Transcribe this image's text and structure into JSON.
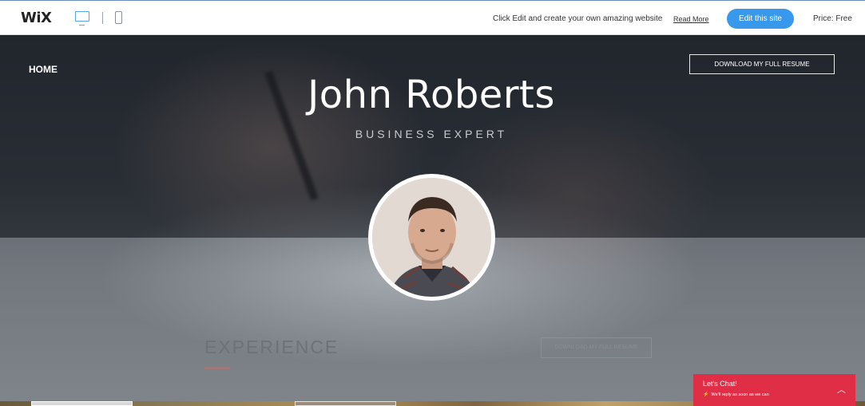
{
  "topbar": {
    "logo": "WiX",
    "promo_text": "Click Edit and create your own amazing website",
    "read_more": "Read More",
    "edit_button": "Edit this site",
    "price": "Price: Free"
  },
  "hero": {
    "nav_home": "HOME",
    "download_resume": "DOWNLOAD MY FULL RESUME",
    "name": "John Roberts",
    "subtitle": "BUSINESS EXPERT"
  },
  "experience": {
    "title": "EXPERIENCE",
    "download_resume": "DOWNLOAD MY FULL RESUME"
  },
  "chat": {
    "title": "Let's Chat!",
    "subtitle": "We'll reply as soon as we can",
    "bolt_icon": "lightning-icon",
    "chevron_icon": "chevron-up-icon"
  },
  "colors": {
    "edit_button": "#3899ec",
    "chat": "#e02e47",
    "desktop_icon": "#59a8e0"
  }
}
